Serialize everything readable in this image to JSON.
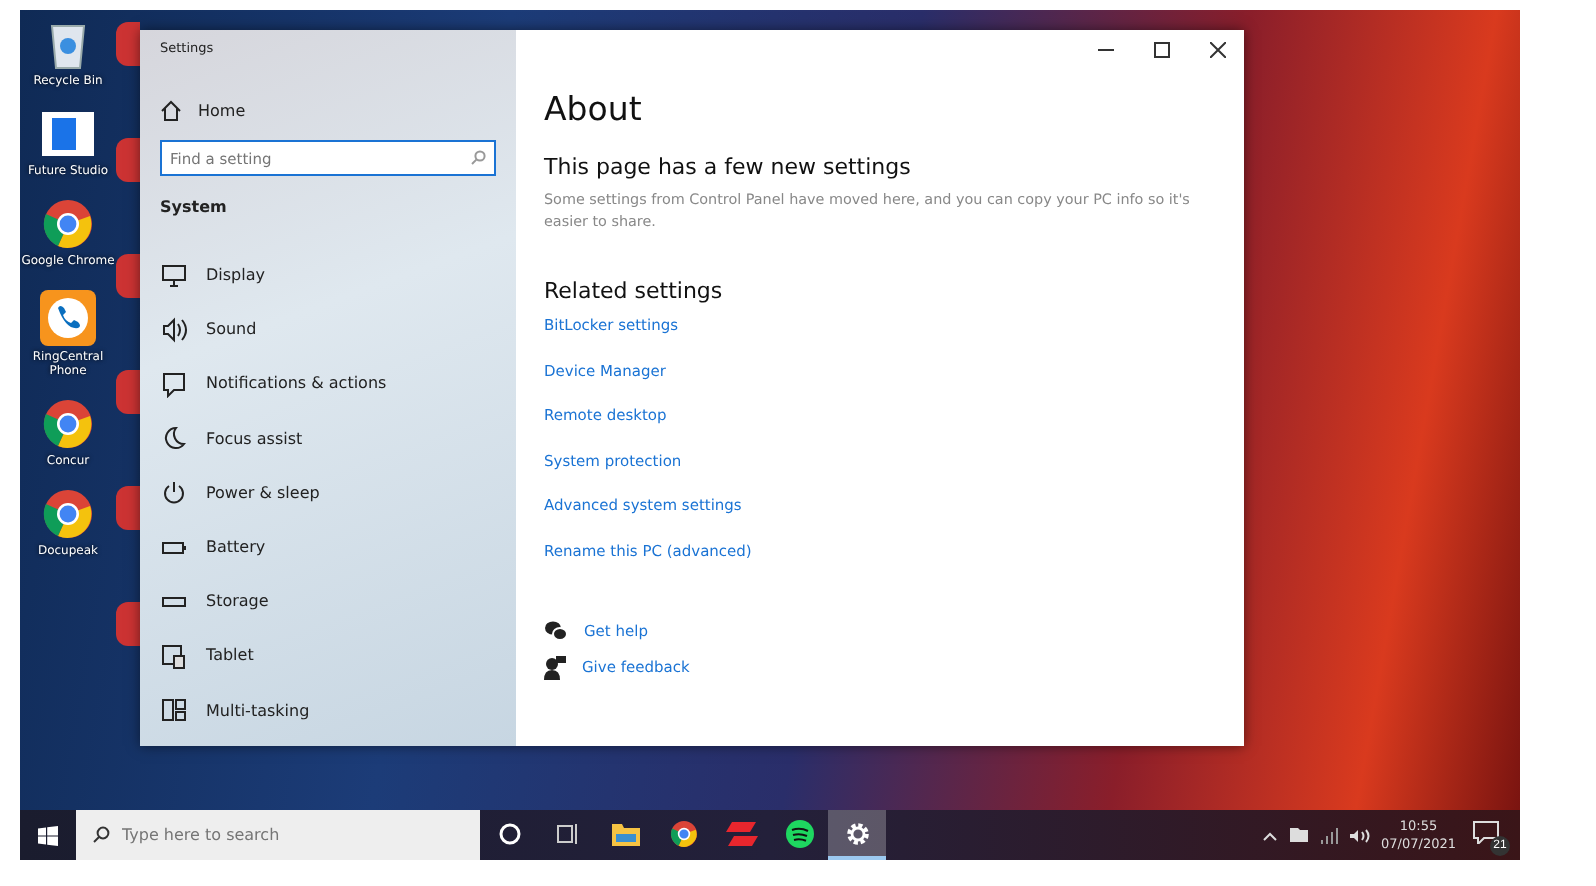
{
  "desktop": {
    "icons": [
      {
        "label": "Recycle Bin",
        "kind": "bin"
      },
      {
        "label": "Future Studio",
        "kind": "window"
      },
      {
        "label": "Google Chrome",
        "kind": "chrome"
      },
      {
        "label": "RingCentral Phone",
        "kind": "phone"
      },
      {
        "label": "Concur",
        "kind": "chrome"
      },
      {
        "label": "Docupeak",
        "kind": "chrome"
      }
    ]
  },
  "settings_window": {
    "title": "Settings",
    "home": "Home",
    "search": {
      "placeholder": "Find a setting"
    },
    "section": "System",
    "nav_items": [
      {
        "label": "Display",
        "kind": "display"
      },
      {
        "label": "Sound",
        "kind": "sound"
      },
      {
        "label": "Notifications & actions",
        "kind": "notifications"
      },
      {
        "label": "Focus assist",
        "kind": "moon"
      },
      {
        "label": "Power & sleep",
        "kind": "power"
      },
      {
        "label": "Battery",
        "kind": "battery"
      },
      {
        "label": "Storage",
        "kind": "storage"
      },
      {
        "label": "Tablet",
        "kind": "tablet"
      },
      {
        "label": "Multi-tasking",
        "kind": "multitasking"
      }
    ],
    "page_title": "About",
    "notice": {
      "heading": "This page has a few new settings",
      "text": "Some settings from Control Panel have moved here, and you can copy your PC info so it's easier to share."
    },
    "related": {
      "heading": "Related settings",
      "links": [
        "BitLocker settings",
        "Device Manager",
        "Remote desktop",
        "System protection",
        "Advanced system settings",
        "Rename this PC (advanced)"
      ]
    },
    "help_links": [
      {
        "label": "Get help",
        "kind": "help"
      },
      {
        "label": "Give feedback",
        "kind": "feedback"
      }
    ]
  },
  "taskbar": {
    "search": {
      "placeholder": "Type here to search"
    },
    "apps": [
      {
        "kind": "cortana",
        "selected": false
      },
      {
        "kind": "taskview",
        "selected": false
      },
      {
        "kind": "explorer",
        "selected": false
      },
      {
        "kind": "chrome",
        "selected": false
      },
      {
        "kind": "redapp",
        "selected": false
      },
      {
        "kind": "spotify",
        "selected": false
      },
      {
        "kind": "settings",
        "selected": true
      }
    ],
    "clock": {
      "time": "10:55",
      "date": "07/07/2021"
    },
    "notifications": {
      "badge": "21"
    }
  }
}
